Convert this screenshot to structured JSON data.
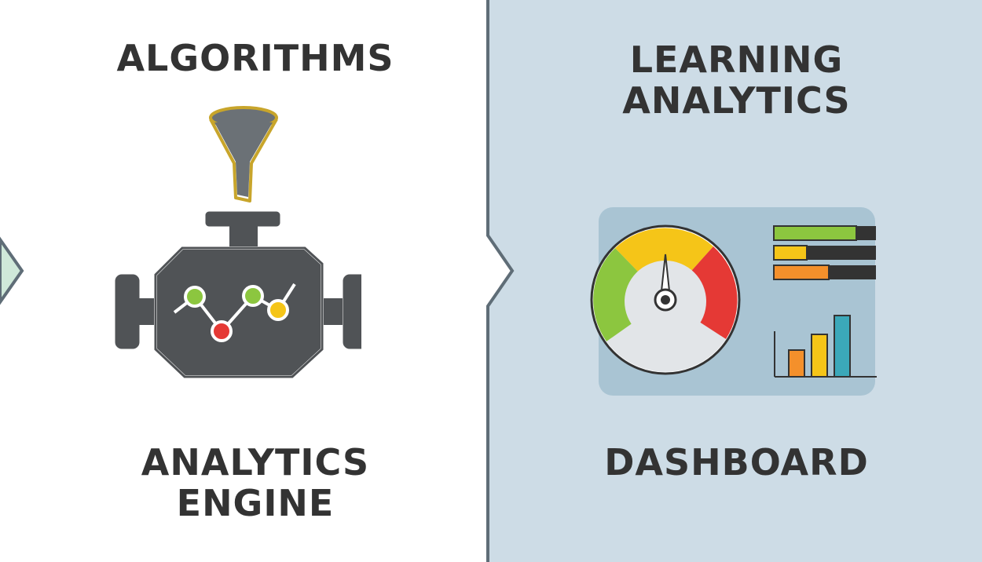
{
  "left_panel": {
    "top_title": "ALGORITHMS",
    "icon": "engine-with-funnel-icon",
    "bottom_title_lines": [
      "ANALYTICS",
      "ENGINE"
    ]
  },
  "right_panel": {
    "top_title_lines": [
      "LEARNING",
      "ANALYTICS"
    ],
    "icon": "dashboard-gauge-icon",
    "bottom_title": "DASHBOARD"
  },
  "colors": {
    "left_bg": "#ffffff",
    "right_bg": "#cddce6",
    "edge_green": "#cfe8d9",
    "divider": "#5f6d77",
    "engine_dark": "#505356",
    "funnel_gold": "#c8a52b",
    "green": "#8cc63f",
    "yellow": "#f5c518",
    "red": "#e53935",
    "orange": "#f4902b",
    "teal": "#3ba8b9",
    "dashboard_panel": "#a9c4d3"
  }
}
